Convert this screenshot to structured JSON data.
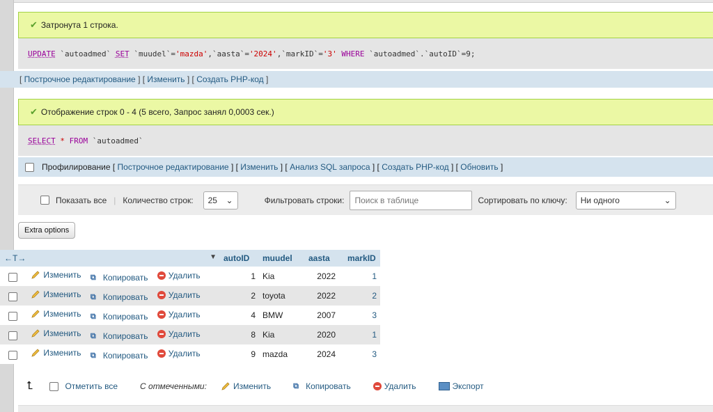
{
  "query1": {
    "message": "Затронута 1 строка.",
    "sql": {
      "kw1": "UPDATE",
      "t1": "`autoadmed`",
      "kw2": "SET",
      "c1": "`muudel`",
      "eq": " = ",
      "v1": "'mazda'",
      "comma": ", ",
      "c2": "`aasta`",
      "v2": "'2024'",
      "c3": "`markID`",
      "v3": "'3'",
      "kw3": "WHERE",
      "c4": "`autoadmed`.`autoID`",
      "v4": "9",
      "end": ";"
    },
    "links": [
      "Построчное редактирование",
      "Изменить",
      "Создать PHP-код"
    ]
  },
  "query2": {
    "message": "Отображение строк 0 - 4 (5 всего, Запрос занял 0,0003 сек.)",
    "sql": {
      "kw1": "SELECT",
      "star": "*",
      "kw2": "FROM",
      "t1": "`autoadmed`"
    },
    "profiling_label": "Профилирование",
    "links": [
      "Построчное редактирование",
      "Изменить",
      "Анализ SQL запроса",
      "Создать PHP-код",
      "Обновить"
    ]
  },
  "nav": {
    "show_all": "Показать все",
    "rows_label": "Количество строк:",
    "rows_value": "25",
    "filter_label": "Фильтровать строки:",
    "filter_placeholder": "Поиск в таблице",
    "sort_label": "Сортировать по ключу:",
    "sort_value": "Ни одного"
  },
  "extra_options": "Extra options",
  "table": {
    "arrows": "←T→",
    "sort_marker": "▼",
    "columns": [
      "autoID",
      "muudel",
      "aasta",
      "markID"
    ],
    "actions": {
      "edit": "Изменить",
      "copy": "Копировать",
      "delete": "Удалить"
    },
    "rows": [
      {
        "autoID": "1",
        "muudel": "Kia",
        "aasta": "2022",
        "markID": "1"
      },
      {
        "autoID": "2",
        "muudel": "toyota",
        "aasta": "2022",
        "markID": "2"
      },
      {
        "autoID": "4",
        "muudel": "BMW",
        "aasta": "2007",
        "markID": "3"
      },
      {
        "autoID": "8",
        "muudel": "Kia",
        "aasta": "2020",
        "markID": "1"
      },
      {
        "autoID": "9",
        "muudel": "mazda",
        "aasta": "2024",
        "markID": "3"
      }
    ]
  },
  "bulk": {
    "check_all": "Отметить все",
    "with_selected": "С отмеченными:",
    "edit": "Изменить",
    "copy": "Копировать",
    "delete": "Удалить",
    "export": "Экспорт"
  },
  "colors": {
    "success_bg": "#ebf8a4",
    "link": "#235a81",
    "row_alt": "#e6e6e6",
    "header_bg": "#d5e3ee"
  }
}
